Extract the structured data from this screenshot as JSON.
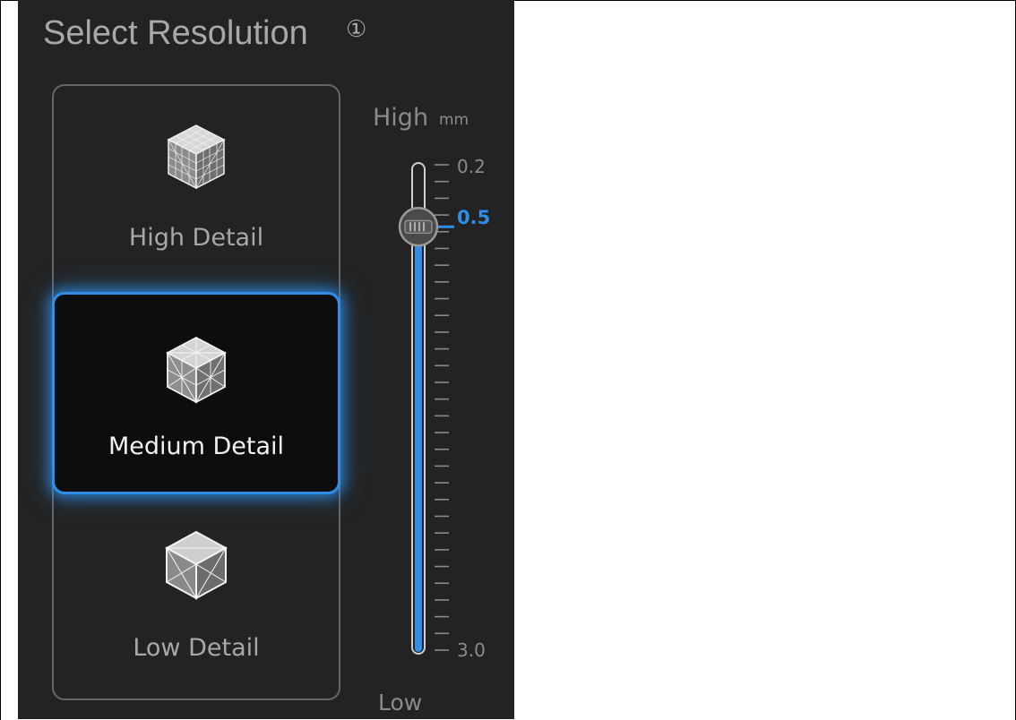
{
  "panel": {
    "title": "Select Resolution",
    "info_glyph": "①"
  },
  "options": [
    {
      "id": "high",
      "label": "High Detail",
      "icon": "high-detail-cube-icon",
      "selected": false
    },
    {
      "id": "medium",
      "label": "Medium Detail",
      "icon": "medium-detail-cube-icon",
      "selected": true
    },
    {
      "id": "low",
      "label": "Low Detail",
      "icon": "low-detail-cube-icon",
      "selected": false
    }
  ],
  "slider": {
    "high_label": "High",
    "low_label": "Low",
    "unit": "mm",
    "min_tick_label": "0.2",
    "max_tick_label": "3.0",
    "current_value_label": "0.5",
    "value_fraction": 0.1
  },
  "colors": {
    "accent": "#2f8ee8",
    "panel_bg": "#232323",
    "text_muted": "#a8a8a8"
  }
}
